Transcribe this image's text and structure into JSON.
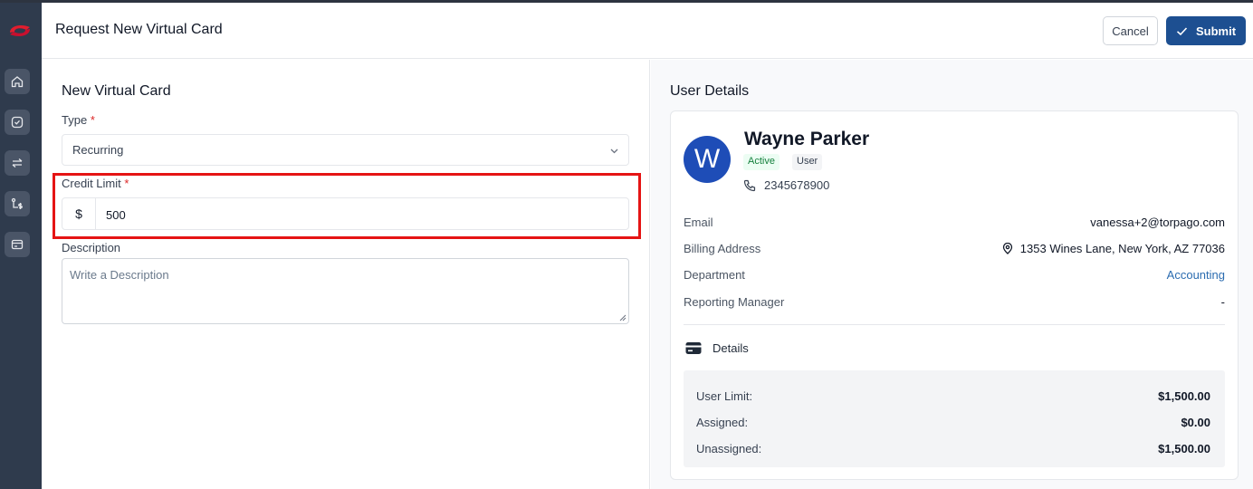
{
  "header": {
    "title": "Request New Virtual Card",
    "cancel_label": "Cancel",
    "submit_label": "Submit"
  },
  "sidebar": {
    "items": [
      {
        "icon": "home-icon"
      },
      {
        "icon": "check-circle-icon"
      },
      {
        "icon": "transfer-icon"
      },
      {
        "icon": "route-dollar-icon"
      },
      {
        "icon": "card-icon"
      }
    ]
  },
  "form": {
    "title": "New Virtual Card",
    "type_label": "Type",
    "type_value": "Recurring",
    "credit_limit_label": "Credit Limit",
    "credit_limit_prefix": "$",
    "credit_limit_value": "500",
    "description_label": "Description",
    "description_placeholder": "Write a Description",
    "required_mark": "*"
  },
  "user": {
    "section_title": "User Details",
    "avatar_initial": "W",
    "name": "Wayne Parker",
    "status": "Active",
    "role": "User",
    "phone": "2345678900",
    "fields": [
      {
        "label": "Email",
        "value": "vanessa+2@torpago.com"
      },
      {
        "label": "Billing Address",
        "value": "1353 Wines Lane, New York, AZ 77036"
      },
      {
        "label": "Department",
        "value": "Accounting"
      },
      {
        "label": "Reporting Manager",
        "value": "-"
      }
    ],
    "details_title": "Details",
    "details": [
      {
        "label": "User Limit:",
        "value": "$1,500.00"
      },
      {
        "label": "Assigned:",
        "value": "$0.00"
      },
      {
        "label": "Unassigned:",
        "value": "$1,500.00"
      }
    ]
  },
  "colors": {
    "sidebar": "#2f3b4d",
    "primary": "#1d4f91",
    "highlight": "#e51414",
    "avatar": "#1e4db7",
    "link": "#2b6cb0"
  }
}
